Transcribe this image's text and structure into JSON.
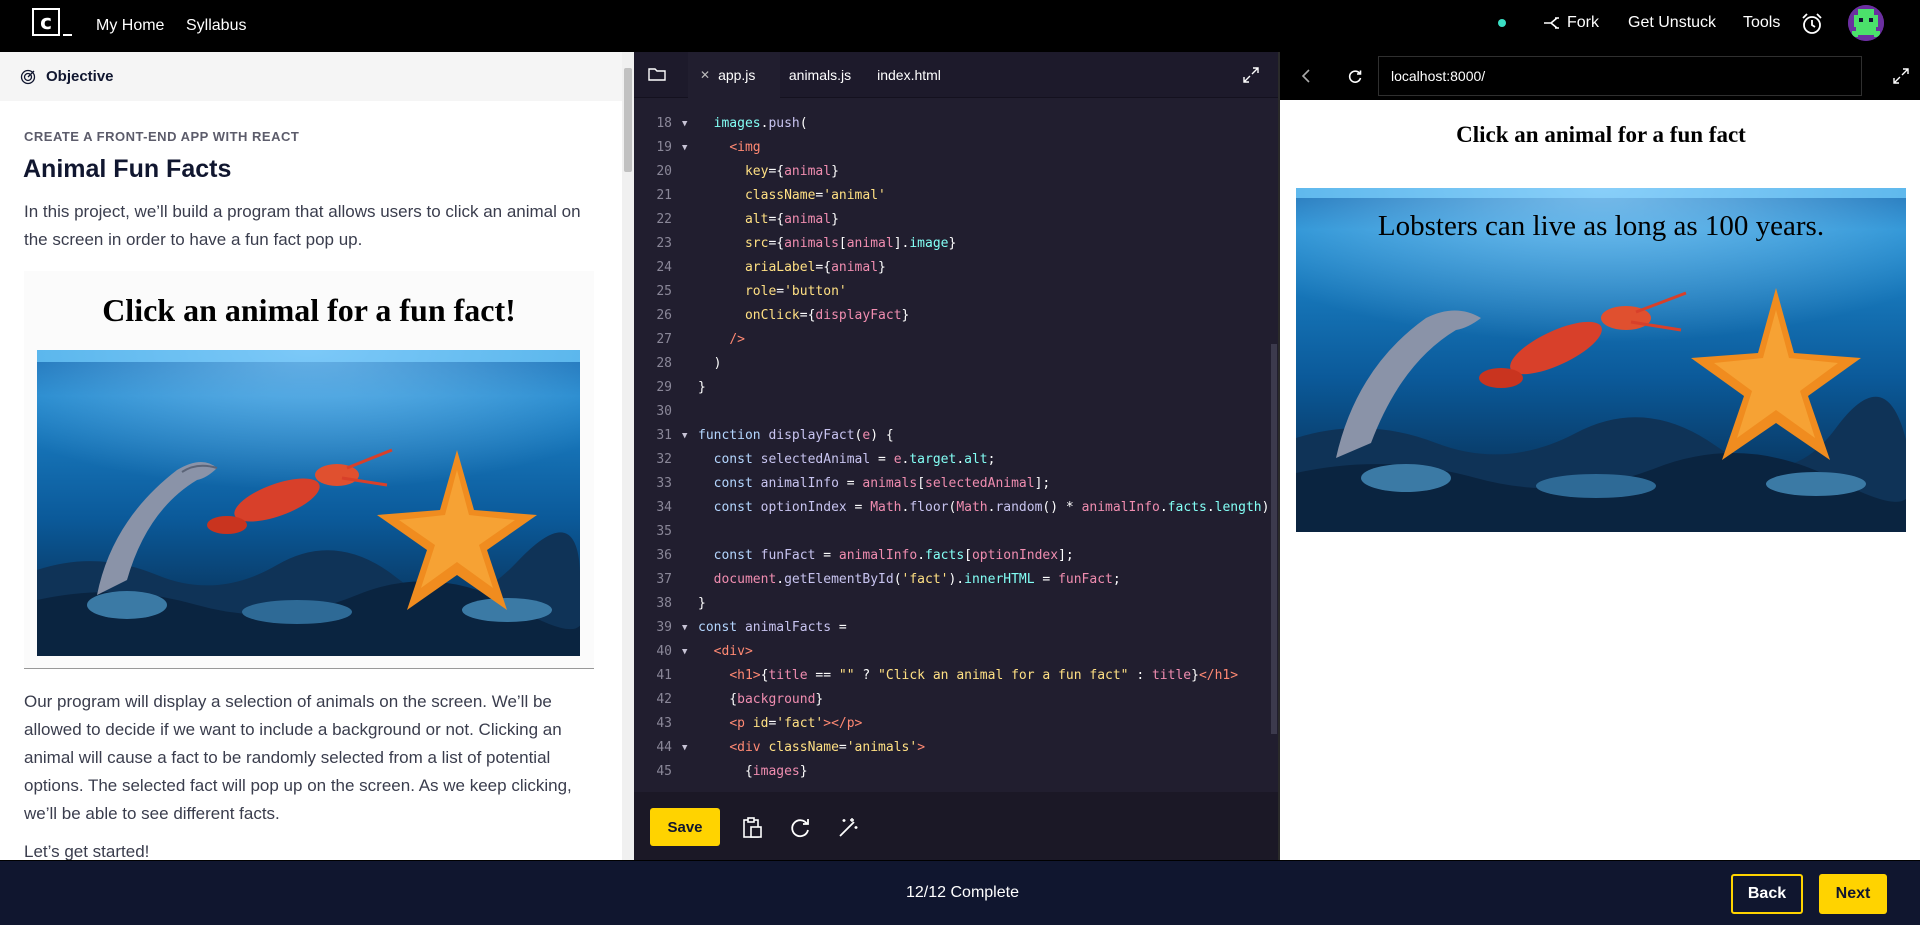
{
  "topbar": {
    "logo": "c",
    "my_home": "My Home",
    "syllabus": "Syllabus",
    "fork": "Fork",
    "get_unstuck": "Get Unstuck",
    "tools": "Tools"
  },
  "lesson": {
    "objective_label": "Objective",
    "eyebrow": "CREATE A FRONT-END APP WITH REACT",
    "title": "Animal Fun Facts",
    "intro": "In this project, we’ll build a program that allows users to click an animal on the screen in order to have a fun fact pop up.",
    "preview_heading": "Click an animal for a fun fact!",
    "body": "Our program will display a selection of animals on the screen. We’ll be allowed to decide if we want to include a background or not. Clicking an animal will cause a fact to be randomly selected from a list of potential options. The selected fact will pop up on the screen. As we keep clicking, we’ll be able to see different facts.",
    "body_cont": "Let’s get started!"
  },
  "editor": {
    "tabs": [
      "app.js",
      "animals.js",
      "index.html"
    ],
    "active_tab": "app.js",
    "save_label": "Save",
    "line_numbers": [
      "18",
      "19",
      "20",
      "21",
      "22",
      "23",
      "24",
      "25",
      "26",
      "27",
      "28",
      "29",
      "30",
      "31",
      "32",
      "33",
      "34",
      "35",
      "36",
      "37",
      "38",
      "39",
      "40",
      "41",
      "42",
      "43",
      "44",
      "45"
    ]
  },
  "browser": {
    "url": "localhost:8000/",
    "heading": "Click an animal for a fun fact",
    "fact": "Lobsters can live as long as 100 years."
  },
  "footer": {
    "progress": "12/12 Complete",
    "back_label": "Back",
    "next_label": "Next"
  },
  "colors": {
    "accent": "#ffd300",
    "navy": "#10162f",
    "editor_bg": "#211e2f",
    "status_dot": "#3adfc4"
  }
}
